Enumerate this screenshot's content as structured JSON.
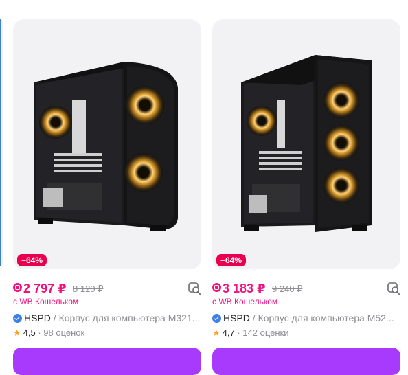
{
  "accent": "#a73afd",
  "price_color": "#f1117e",
  "products": [
    {
      "discount": "−64%",
      "price": "2 797 ₽",
      "old_price": "8 120 ₽",
      "wallet_text": "с WB Кошельком",
      "brand": "HSPD",
      "separator": " / ",
      "name": "Корпус для компьютера M321...",
      "rating": "4,5",
      "reviews": " · 98 оценок"
    },
    {
      "discount": "−64%",
      "price": "3 183 ₽",
      "old_price": "9 240 ₽",
      "wallet_text": "с WB Кошельком",
      "brand": "HSPD",
      "separator": " / ",
      "name": "Корпус для компьютера M52...",
      "rating": "4,7",
      "reviews": " · 142 оценки"
    }
  ]
}
